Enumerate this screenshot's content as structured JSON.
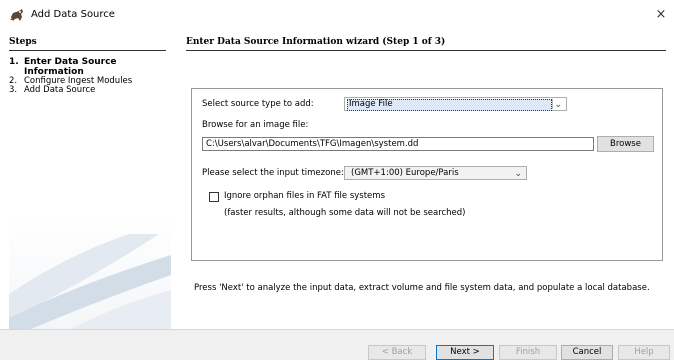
{
  "window": {
    "title": "Add Data Source",
    "close_symbol": "×",
    "app_icon": "autopsy-dog-icon"
  },
  "steps": {
    "heading": "Steps",
    "items": [
      {
        "num": "1.",
        "label": "Enter Data Source Information",
        "active": true
      },
      {
        "num": "2.",
        "label": "Configure Ingest Modules",
        "active": false
      },
      {
        "num": "3.",
        "label": "Add Data Source",
        "active": false
      }
    ]
  },
  "main": {
    "heading": "Enter Data Source Information wizard (Step 1 of 3)",
    "source_type_label": "Select source type to add:",
    "source_type_value": "Image File",
    "browse_label": "Browse for an image file:",
    "path_value": "C:\\Users\\alvar\\Documents\\TFG\\Imagen\\system.dd",
    "browse_button": "Browse",
    "timezone_label": "Please select the input timezone:",
    "timezone_value": "(GMT+1:00) Europe/Paris",
    "orphan_checkbox_label": "Ignore orphan files in FAT file systems",
    "orphan_checkbox_checked": false,
    "orphan_note": "(faster results, although some data will not be searched)",
    "next_note": "Press 'Next' to analyze the input data, extract volume and file system data, and populate a local database."
  },
  "footer": {
    "back": "< Back",
    "next": "Next >",
    "finish": "Finish",
    "cancel": "Cancel",
    "help": "Help"
  },
  "colors": {
    "accent": "#0078d7",
    "footer_bg": "#f0f0f0",
    "deco_blue": "#d3dde8"
  }
}
